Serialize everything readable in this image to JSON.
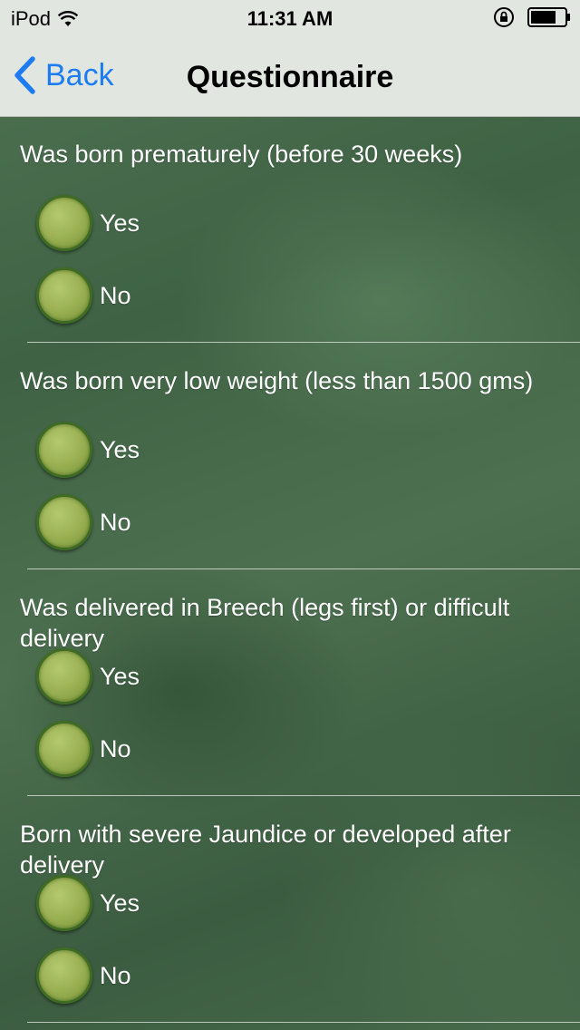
{
  "status_bar": {
    "carrier": "iPod",
    "time": "11:31 AM",
    "icons": [
      "wifi-icon",
      "orientation-lock-icon",
      "battery-icon"
    ]
  },
  "nav": {
    "back_label": "Back",
    "title": "Questionnaire"
  },
  "colors": {
    "accent": "#1e7cf2",
    "background": "#46694a",
    "bar": "#e1e6e0"
  },
  "questions": [
    {
      "text": "Was born prematurely (before 30 weeks)",
      "options": [
        "Yes",
        "No"
      ]
    },
    {
      "text": "Was born very low weight (less than 1500 gms)",
      "options": [
        "Yes",
        "No"
      ]
    },
    {
      "text": "Was delivered in Breech (legs first) or difficult delivery",
      "options": [
        "Yes",
        "No"
      ]
    },
    {
      "text": "Born with severe Jaundice or developed after delivery",
      "options": [
        "Yes",
        "No"
      ]
    }
  ]
}
